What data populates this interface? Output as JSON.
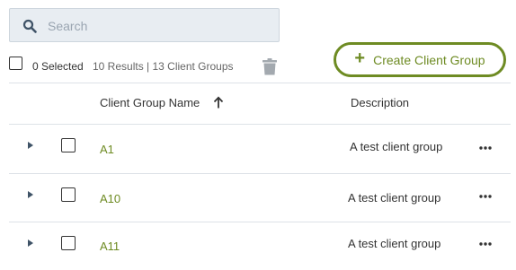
{
  "search": {
    "placeholder": "Search",
    "value": ""
  },
  "toolbar": {
    "selected_label": "0 Selected",
    "results_label": "10 Results | 13 Client Groups",
    "create_button_label": "Create Client Group"
  },
  "table": {
    "columns": [
      {
        "label": "Client Group Name",
        "sort": "ascending"
      },
      {
        "label": "Description"
      }
    ],
    "rows": [
      {
        "name": "A1",
        "description": "A test client group"
      },
      {
        "name": "A10",
        "description": "A test client group"
      },
      {
        "name": "A11",
        "description": "A test client group"
      }
    ]
  },
  "colors": {
    "accent": "#6e8b23",
    "search_bg": "#e8edf2",
    "divider": "#dde2e7"
  },
  "icons": {
    "search": "search-icon",
    "delete": "trash-icon",
    "create": "plus-icon",
    "sort": "arrow-up-icon",
    "expand": "caret-right-icon",
    "row_actions": "more-horizontal-icon"
  }
}
